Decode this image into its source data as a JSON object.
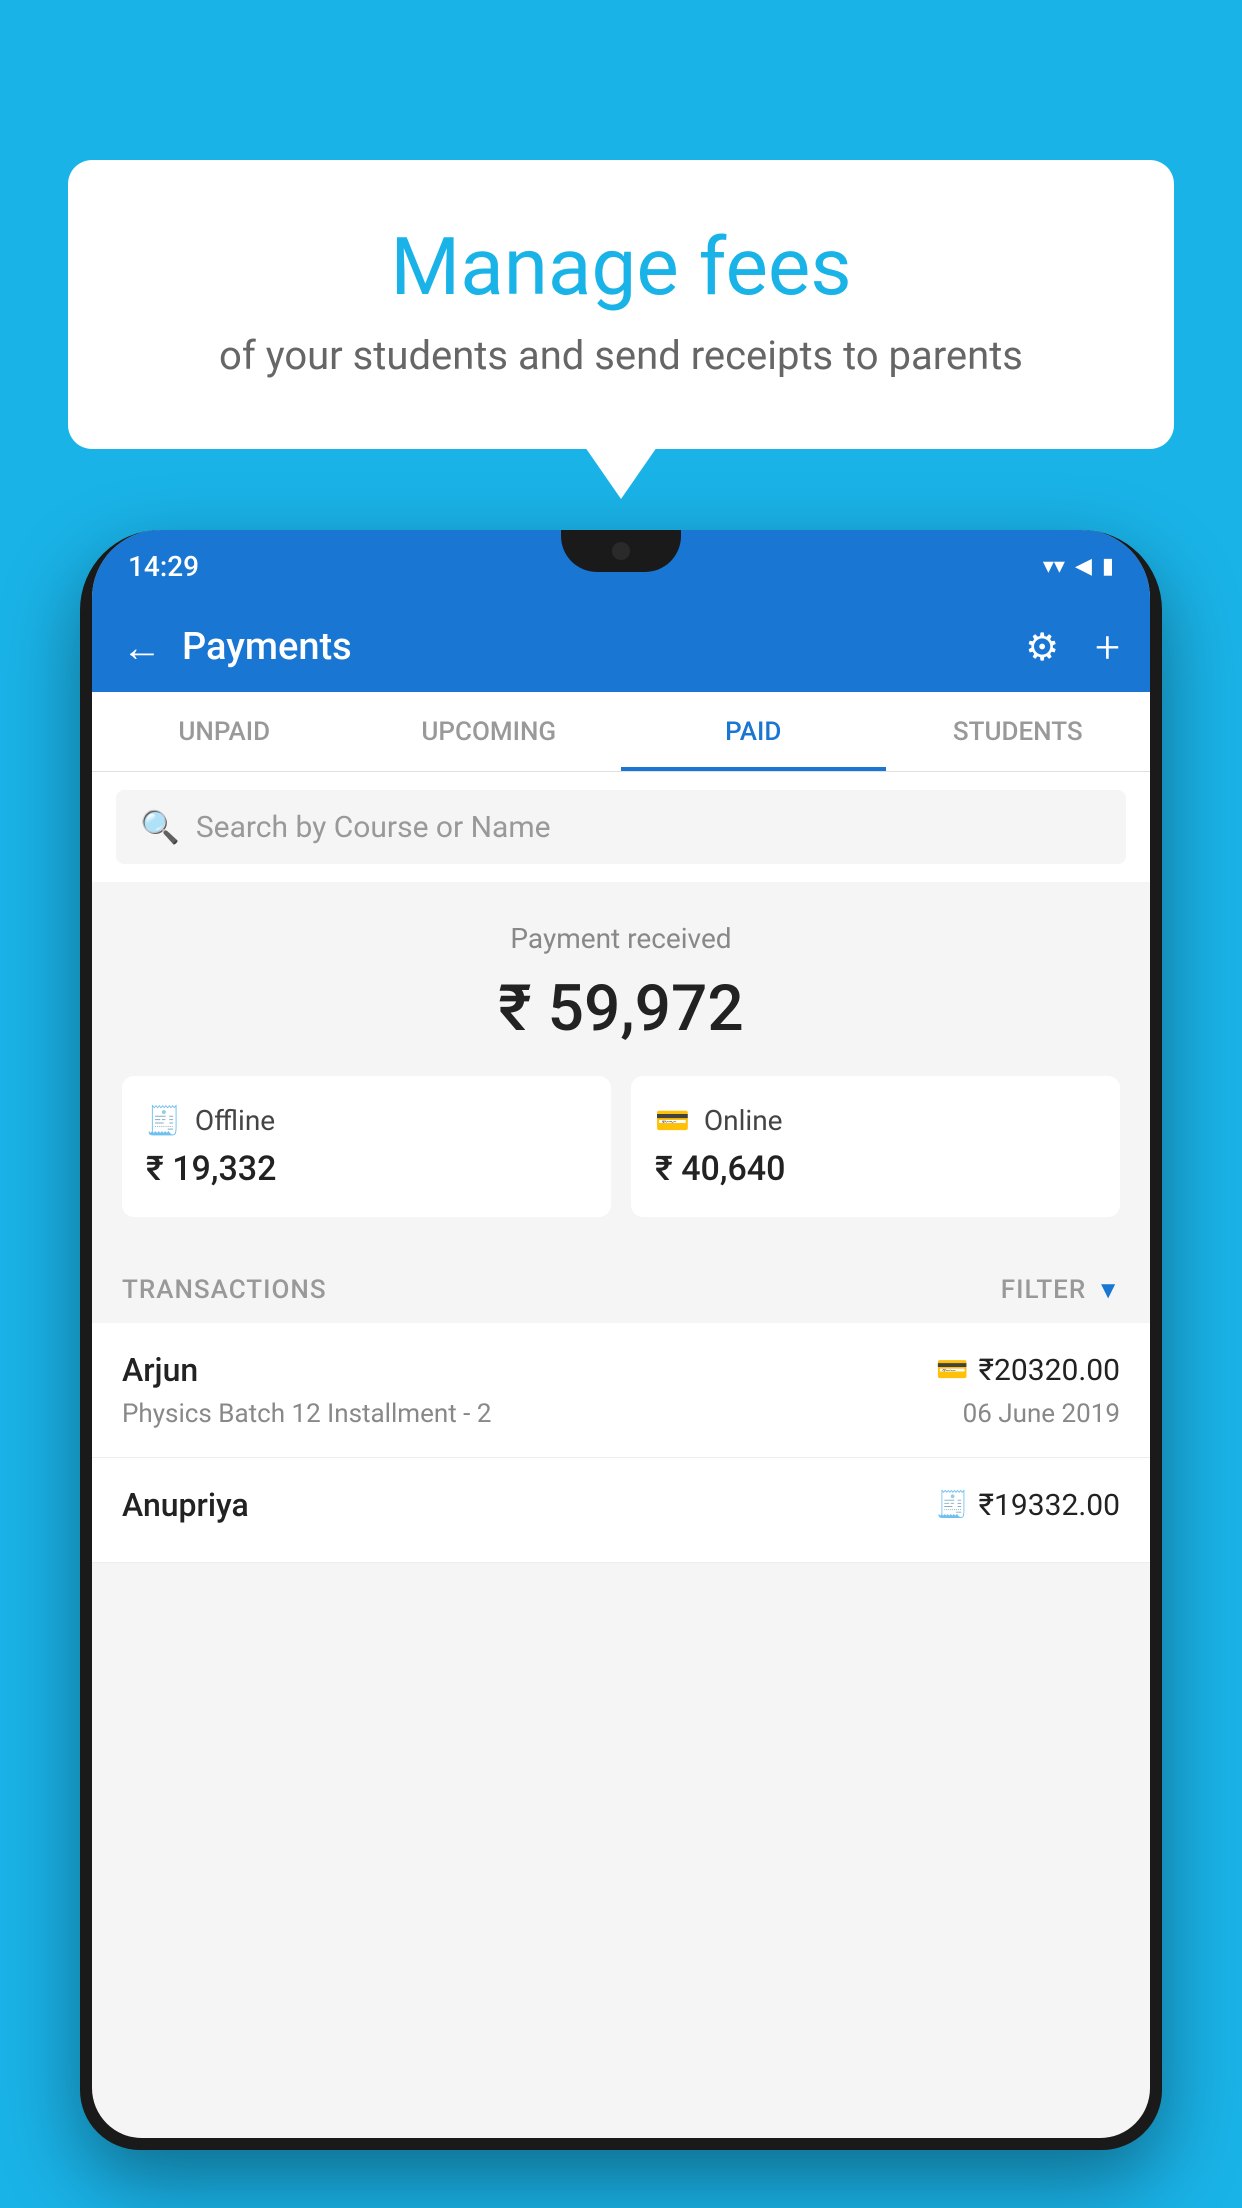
{
  "background_color": "#1ab3e8",
  "bubble": {
    "title": "Manage fees",
    "subtitle": "of your students and send receipts to parents"
  },
  "status_bar": {
    "time": "14:29",
    "wifi_icon": "▼",
    "signal_icon": "▲",
    "battery_icon": "▮"
  },
  "header": {
    "title": "Payments",
    "back_label": "←",
    "gear_label": "⚙",
    "plus_label": "+"
  },
  "tabs": [
    {
      "label": "UNPAID",
      "active": false
    },
    {
      "label": "UPCOMING",
      "active": false
    },
    {
      "label": "PAID",
      "active": true
    },
    {
      "label": "STUDENTS",
      "active": false
    }
  ],
  "search": {
    "placeholder": "Search by Course or Name"
  },
  "payment_summary": {
    "received_label": "Payment received",
    "total_amount": "₹ 59,972",
    "offline_label": "Offline",
    "offline_amount": "₹ 19,332",
    "online_label": "Online",
    "online_amount": "₹ 40,640"
  },
  "transactions": {
    "header_label": "TRANSACTIONS",
    "filter_label": "FILTER",
    "items": [
      {
        "name": "Arjun",
        "amount": "₹20320.00",
        "course": "Physics Batch 12 Installment - 2",
        "date": "06 June 2019",
        "type": "online"
      },
      {
        "name": "Anupriya",
        "amount": "₹19332.00",
        "course": "",
        "date": "",
        "type": "offline"
      }
    ]
  }
}
